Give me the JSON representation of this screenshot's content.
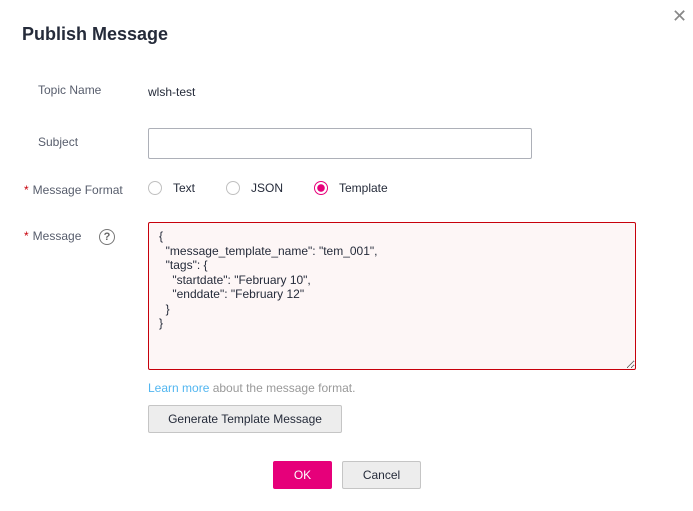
{
  "dialog": {
    "title": "Publish Message",
    "close_icon": "close-icon"
  },
  "fields": {
    "topic_label": "Topic Name",
    "topic_value": "wlsh-test",
    "subject_label": "Subject",
    "subject_value": "",
    "format_label": "Message Format",
    "required_mark": "*",
    "format_options": [
      {
        "label": "Text",
        "selected": false
      },
      {
        "label": "JSON",
        "selected": false
      },
      {
        "label": "Template",
        "selected": true
      }
    ],
    "message_label": "Message",
    "help_icon": "?",
    "message_value": "{\n  \"message_template_name\": \"tem_001\",\n  \"tags\": {\n    \"startdate\": \"February 10\",\n    \"enddate\": \"February 12\"\n  }\n}",
    "learn_more": "Learn more",
    "learn_more_suffix": " about the message format.",
    "generate_button": "Generate Template Message"
  },
  "footer": {
    "ok": "OK",
    "cancel": "Cancel"
  },
  "colors": {
    "accent": "#e6007a",
    "error": "#c7000b",
    "link": "#52b6f0"
  }
}
